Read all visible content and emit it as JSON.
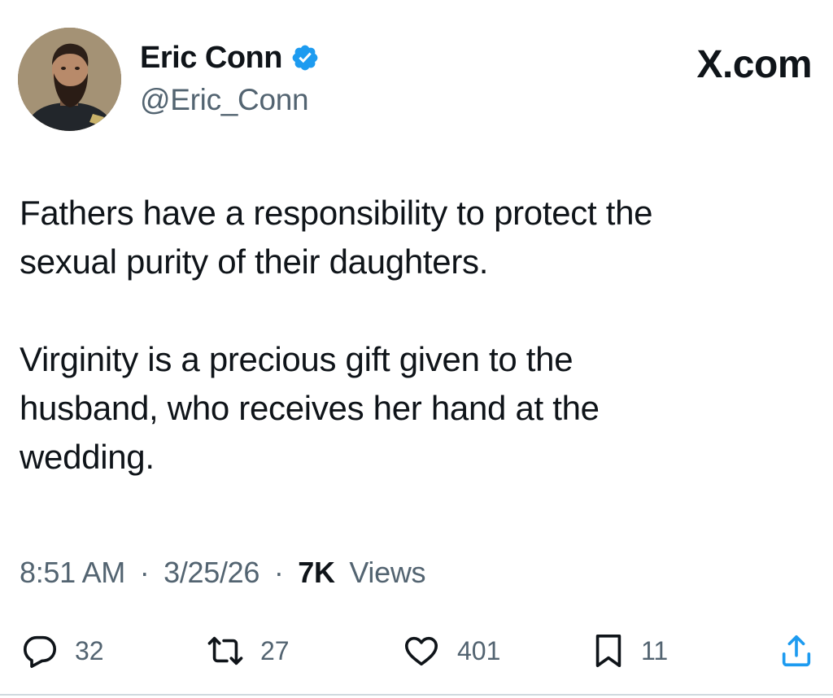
{
  "author": {
    "display_name": "Eric Conn",
    "handle": "@Eric_Conn",
    "verified": true,
    "verified_color": "#1d9bf0"
  },
  "site_label": "X.com",
  "tweet": {
    "paragraphs": [
      "Fathers have a responsibility to protect the\nsexual purity of their daughters.",
      "Virginity is a precious gift given to the\nhusband, who receives her hand at the\nwedding."
    ]
  },
  "meta": {
    "time": "8:51 AM",
    "separator": "·",
    "date": "3/25/26",
    "views_count": "7K",
    "views_label": "Views"
  },
  "actions": {
    "replies": "32",
    "reposts": "27",
    "likes": "401",
    "bookmarks": "11",
    "icons": {
      "replies": "reply-icon",
      "reposts": "repost-icon",
      "likes": "heart-icon",
      "bookmarks": "bookmark-icon",
      "share": "share-icon"
    }
  },
  "colors": {
    "text_primary": "#0f1419",
    "text_secondary": "#536471",
    "divider": "#cfd9de"
  }
}
